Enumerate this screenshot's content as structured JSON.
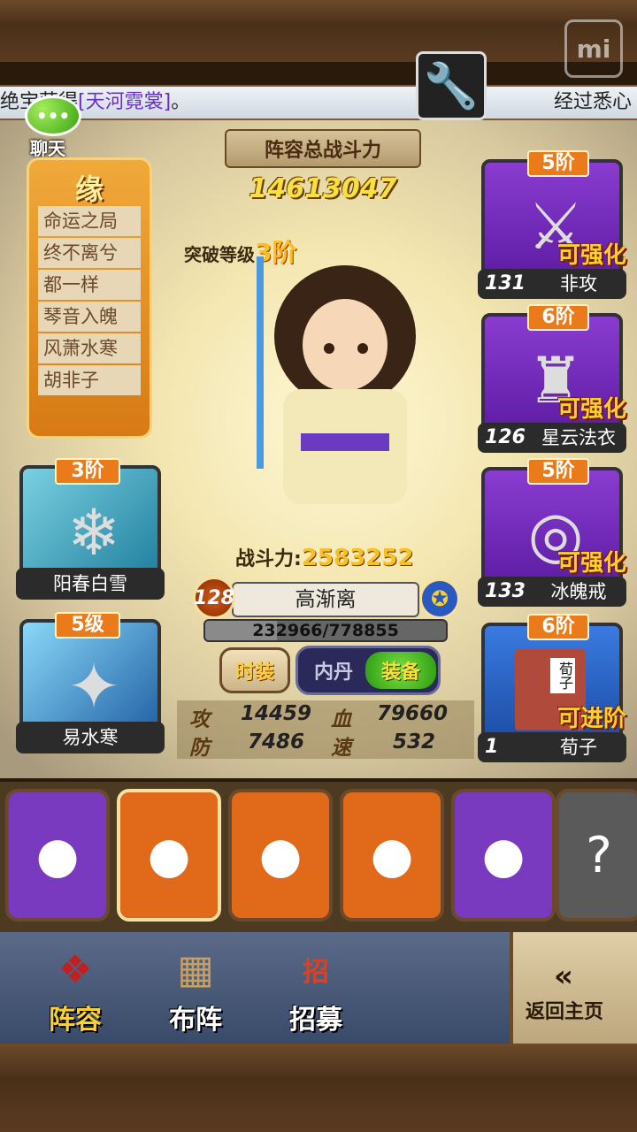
{
  "marquee": {
    "left_text": "绝宝获得",
    "item": "[天河霓裳]",
    "left_tail": "。",
    "right_text": "经过悉心"
  },
  "chat": {
    "label": "聊天"
  },
  "power": {
    "title": "阵容总战斗力",
    "value": "14613047"
  },
  "breakthrough": {
    "label": "突破等级",
    "level": "3",
    "unit": "阶"
  },
  "fate": {
    "title": "缘",
    "items": [
      "命运之局",
      "终不离兮",
      "都一样",
      "琴音入魄",
      "风萧水寒",
      "胡非子"
    ]
  },
  "skills": [
    {
      "badge": "3阶",
      "name": "阳春白雪",
      "color": "#2aa0b0"
    },
    {
      "badge": "5级",
      "name": "易水寒",
      "color": "#1a80c0"
    }
  ],
  "equipment": [
    {
      "badge": "5阶",
      "level": "131",
      "name": "非攻",
      "status": "可强化"
    },
    {
      "badge": "6阶",
      "level": "126",
      "name": "星云法衣",
      "status": "可强化"
    },
    {
      "badge": "5阶",
      "level": "133",
      "name": "冰魄戒",
      "status": "可强化"
    },
    {
      "badge": "6阶",
      "level": "1",
      "name": "荀子",
      "status": "可进阶",
      "book_title": "荀子"
    }
  ],
  "hero": {
    "fight_label": "战斗力:",
    "fight_value": "2583252",
    "level": "128",
    "name": "高渐离",
    "exp": "232966/778855",
    "exp_fraction": 0.299
  },
  "buttons": {
    "fashion": "时装",
    "neidan": "内丹",
    "equip": "装备"
  },
  "stats": {
    "atk_label": "攻",
    "atk": "14459",
    "hp_label": "血",
    "hp": "79660",
    "def_label": "防",
    "def": "7486",
    "spd_label": "速",
    "spd": "532"
  },
  "hero_cards": [
    {
      "icon": "purple-hair-hero",
      "color": "#7a3ac0"
    },
    {
      "icon": "brown-hair-hero",
      "color": "#e06a1a"
    },
    {
      "icon": "blue-hair-hero",
      "color": "#e06a1a"
    },
    {
      "icon": "bearded-hero",
      "color": "#e06a1a"
    },
    {
      "icon": "white-hair-hero",
      "color": "#7a3ac0"
    },
    {
      "icon": "locked-hero",
      "color": "#5a5a5a",
      "mark": "?"
    }
  ],
  "nav": {
    "lineup": "阵容",
    "formation": "布阵",
    "recruit": "招募",
    "recruit_flag": "招",
    "back_arrow": "«",
    "back": "返回主页"
  },
  "colors": {
    "accent_orange": "#ea7a1a",
    "gold_text": "#f8d030",
    "purple_frame": "#7a3ac0"
  }
}
